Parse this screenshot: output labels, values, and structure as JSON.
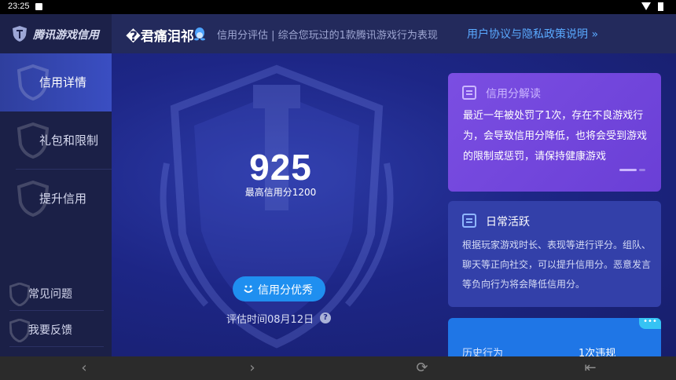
{
  "status_bar": {
    "time": "23:25"
  },
  "header": {
    "app_name": "腾讯游戏信用",
    "nickname": "�君痛泪祁",
    "description": "信用分评估 | 综合您玩过的1款腾讯游戏行为表现",
    "policy_link": "用户协议与隐私政策说明 »"
  },
  "sidebar": {
    "items": [
      {
        "label": "信用详情"
      },
      {
        "label": "礼包和限制"
      },
      {
        "label": "提升信用"
      }
    ],
    "bottom": [
      {
        "label": "常见问题"
      },
      {
        "label": "我要反馈"
      }
    ]
  },
  "score": {
    "value": "925",
    "max_label": "最高信用分1200",
    "level": "信用分优秀",
    "eval_time": "评估时间08月12日",
    "help": "?"
  },
  "cards": {
    "interpretation": {
      "title": "信用分解读",
      "body": "最近一年被处罚了1次，存在不良游戏行为，会导致信用分降低，也将会受到游戏的限制或惩罚，请保持健康游戏"
    },
    "daily": {
      "title": "日常活跃",
      "body": "根据玩家游戏时长、表现等进行评分。组队、聊天等正向社交，可以提升信用分。恶意发言等负向行为将会降低信用分。"
    },
    "history": {
      "label": "历史行为",
      "value": "1次违规",
      "more": "•••"
    }
  },
  "navbar": {
    "back": "‹",
    "forward": "›",
    "refresh": "⟳",
    "exit": "⇤"
  },
  "colors": {
    "accent_blue": "#1f8ff0",
    "card_purple": "#7b4ee2",
    "card_blue": "#3340a9",
    "sidebar": "#1b2047"
  }
}
